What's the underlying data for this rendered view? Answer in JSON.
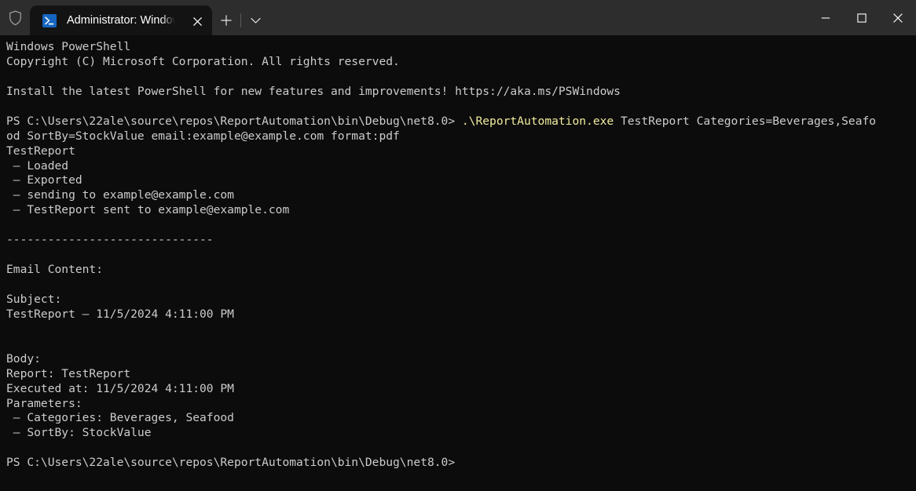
{
  "window": {
    "shield_icon": "shield-icon",
    "tab": {
      "icon": "powershell-icon",
      "title": "Administrator: Windows PowerShell",
      "close_label": "✕"
    },
    "new_tab_label": "+",
    "dropdown_label": "⌄",
    "controls": {
      "minimize": "—",
      "maximize": "□",
      "close": "✕"
    }
  },
  "colors": {
    "titlebar_bg": "#2d2d2d",
    "tab_bg": "#131313",
    "terminal_bg": "#0c0c0c",
    "terminal_fg": "#cccccc",
    "command_fg": "#f0ec9e",
    "tab_icon_bg": "#1565c0"
  },
  "terminal": {
    "lines": [
      {
        "id": "l01",
        "text": "Windows PowerShell"
      },
      {
        "id": "l02",
        "text": "Copyright (C) Microsoft Corporation. All rights reserved."
      },
      {
        "id": "l03",
        "text": ""
      },
      {
        "id": "l04",
        "text": "Install the latest PowerShell for new features and improvements! https://aka.ms/PSWindows"
      },
      {
        "id": "l05",
        "text": ""
      },
      {
        "id": "l06",
        "prompt": "PS C:\\Users\\22ale\\source\\repos\\ReportAutomation\\bin\\Debug\\net8.0> ",
        "command": ".\\ReportAutomation.exe",
        "args": " TestReport Categories=Beverages,Seafo"
      },
      {
        "id": "l07",
        "text": "od SortBy=StockValue email:example@example.com format:pdf"
      },
      {
        "id": "l08",
        "text": "TestReport"
      },
      {
        "id": "l09",
        "text": " – Loaded"
      },
      {
        "id": "l10",
        "text": " – Exported"
      },
      {
        "id": "l11",
        "text": " – sending to example@example.com"
      },
      {
        "id": "l12",
        "text": " – TestReport sent to example@example.com"
      },
      {
        "id": "l13",
        "text": ""
      },
      {
        "id": "l14",
        "text": "------------------------------"
      },
      {
        "id": "l15",
        "text": ""
      },
      {
        "id": "l16",
        "text": "Email Content:"
      },
      {
        "id": "l17",
        "text": ""
      },
      {
        "id": "l18",
        "text": "Subject:"
      },
      {
        "id": "l19",
        "text": "TestReport – 11/5/2024 4:11:00 PM"
      },
      {
        "id": "l20",
        "text": ""
      },
      {
        "id": "l21",
        "text": ""
      },
      {
        "id": "l22",
        "text": "Body:"
      },
      {
        "id": "l23",
        "text": "Report: TestReport"
      },
      {
        "id": "l24",
        "text": "Executed at: 11/5/2024 4:11:00 PM"
      },
      {
        "id": "l25",
        "text": "Parameters:"
      },
      {
        "id": "l26",
        "text": " – Categories: Beverages, Seafood"
      },
      {
        "id": "l27",
        "text": " – SortBy: StockValue"
      },
      {
        "id": "l28",
        "text": ""
      },
      {
        "id": "l29",
        "text": "PS C:\\Users\\22ale\\source\\repos\\ReportAutomation\\bin\\Debug\\net8.0>"
      }
    ]
  }
}
